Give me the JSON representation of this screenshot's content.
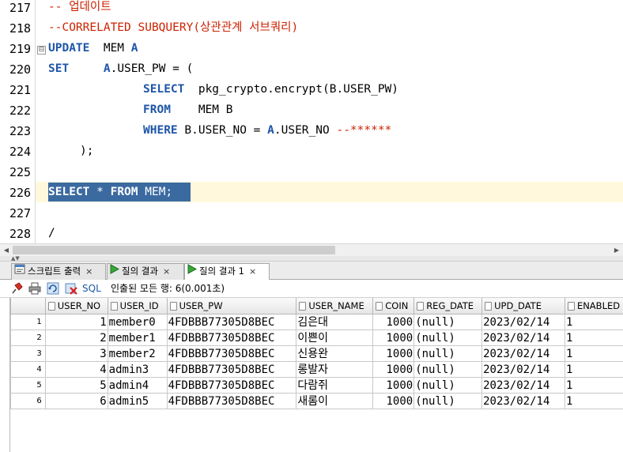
{
  "editor": {
    "lines": [
      {
        "no": "217",
        "text": "-- 업데이트"
      },
      {
        "no": "218",
        "text": "--CORRELATED SUBQUERY(상관관계 서브쿼리)"
      },
      {
        "no": "219",
        "k1": "UPDATE",
        "t1": "  MEM ",
        "k2": "A"
      },
      {
        "no": "220",
        "k1": "SET",
        "t1": "     ",
        "a1": "A",
        "t2": ".USER_PW = ("
      },
      {
        "no": "221",
        "k1": "SELECT",
        "t1": "  pkg_crypto.encrypt(B.USER_PW)"
      },
      {
        "no": "222",
        "k1": "FROM",
        "t1": "    MEM B"
      },
      {
        "no": "223",
        "k1": "WHERE",
        "t1": " B.USER_NO = ",
        "a1": "A",
        "t2": ".USER_NO ",
        "c1": "--******"
      },
      {
        "no": "224",
        "text": ");"
      },
      {
        "no": "225",
        "text": ""
      },
      {
        "no": "226",
        "k1": "SELECT",
        "t1": " * ",
        "k2": "FROM",
        "t2": " MEM;"
      },
      {
        "no": "227",
        "text": ""
      },
      {
        "no": "228",
        "text": "/"
      }
    ],
    "fold_marker": "⊟"
  },
  "tabs": [
    {
      "label": "스크립트 출력",
      "close": "×",
      "icon": "script-output-icon"
    },
    {
      "label": "질의 결과",
      "close": "×",
      "icon": "run-icon"
    },
    {
      "label": "질의 결과 1",
      "close": "×",
      "icon": "run-icon"
    }
  ],
  "toolbar": {
    "sql_label": "SQL",
    "status": "인출된 모든 행: 6(0.001초)",
    "icons": [
      "pin-icon",
      "print-icon",
      "refresh-icon",
      "delete-icon"
    ]
  },
  "grid": {
    "columns": [
      "USER_NO",
      "USER_ID",
      "USER_PW",
      "USER_NAME",
      "COIN",
      "REG_DATE",
      "UPD_DATE",
      "ENABLED"
    ],
    "rows": [
      {
        "rn": "1",
        "cells": [
          "1",
          "member0",
          "4FDBBB77305D8BEC",
          "김은대",
          "1000",
          "(null)",
          "2023/02/14",
          "1"
        ]
      },
      {
        "rn": "2",
        "cells": [
          "2",
          "member1",
          "4FDBBB77305D8BEC",
          "이쁜이",
          "1000",
          "(null)",
          "2023/02/14",
          "1"
        ]
      },
      {
        "rn": "3",
        "cells": [
          "3",
          "member2",
          "4FDBBB77305D8BEC",
          "신용완",
          "1000",
          "(null)",
          "2023/02/14",
          "1"
        ]
      },
      {
        "rn": "4",
        "cells": [
          "4",
          "admin3",
          "4FDBBB77305D8BEC",
          "롱발자",
          "1000",
          "(null)",
          "2023/02/14",
          "1"
        ]
      },
      {
        "rn": "5",
        "cells": [
          "5",
          "admin4",
          "4FDBBB77305D8BEC",
          "다람쥐",
          "1000",
          "(null)",
          "2023/02/14",
          "1"
        ]
      },
      {
        "rn": "6",
        "cells": [
          "6",
          "admin5",
          "4FDBBB77305D8BEC",
          "새롬이",
          "1000",
          "(null)",
          "2023/02/14",
          "1"
        ]
      }
    ]
  },
  "colors": {
    "keyword": "#1f56a8",
    "comment": "#cc2200",
    "selection": "#3b6aa0",
    "current_line": "#fff8dc"
  }
}
